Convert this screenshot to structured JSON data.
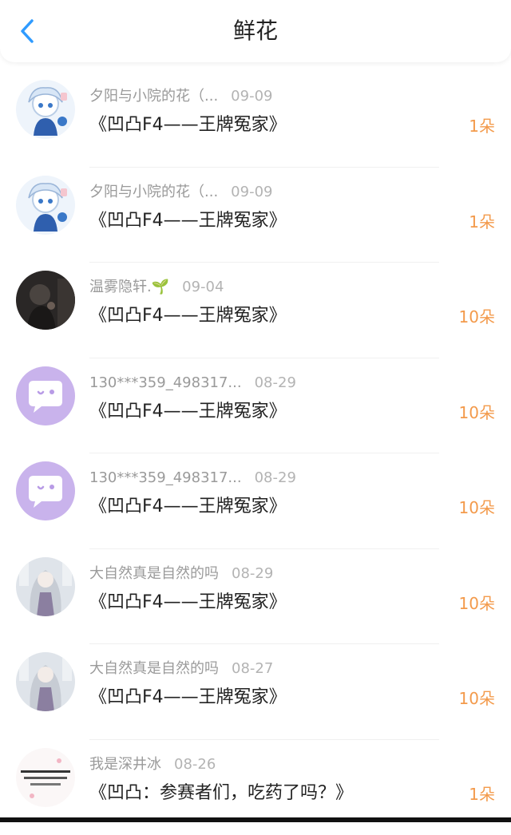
{
  "header": {
    "title": "鲜花",
    "back_icon": "chevron-left-icon",
    "accent_color": "#2f9bff"
  },
  "list": [
    {
      "name": "夕阳与小院的花（...",
      "date": "09-09",
      "book": "《凹凸F4——王牌冤家》",
      "count": "1朵",
      "avatar": "anime-girl-avatar"
    },
    {
      "name": "夕阳与小院的花（...",
      "date": "09-09",
      "book": "《凹凸F4——王牌冤家》",
      "count": "1朵",
      "avatar": "anime-girl-avatar"
    },
    {
      "name": "温雾隐轩.🌱",
      "date": "09-04",
      "book": "《凹凸F4——王牌冤家》",
      "count": "10朵",
      "avatar": "dark-photo-avatar"
    },
    {
      "name": "130***359_498317...",
      "date": "08-29",
      "book": "《凹凸F4——王牌冤家》",
      "count": "10朵",
      "avatar": "default-chat-avatar"
    },
    {
      "name": "130***359_498317...",
      "date": "08-29",
      "book": "《凹凸F4——王牌冤家》",
      "count": "10朵",
      "avatar": "default-chat-avatar"
    },
    {
      "name": "大自然真是自然的吗",
      "date": "08-29",
      "book": "《凹凸F4——王牌冤家》",
      "count": "10朵",
      "avatar": "long-hair-girl-avatar"
    },
    {
      "name": "大自然真是自然的吗",
      "date": "08-27",
      "book": "《凹凸F4——王牌冤家》",
      "count": "10朵",
      "avatar": "long-hair-girl-avatar"
    },
    {
      "name": "我是深井冰",
      "date": "08-26",
      "book": "《凹凸：参赛者们，吃药了吗？》",
      "count": "1朵",
      "avatar": "text-logo-avatar"
    }
  ],
  "colors": {
    "count": "#f39a4b",
    "name": "#9a9a9a",
    "book": "#222222"
  }
}
